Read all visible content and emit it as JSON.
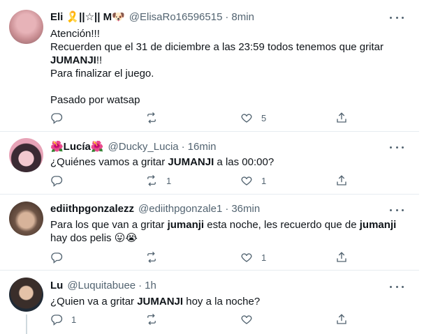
{
  "tweets": [
    {
      "name": "Eli 🎗️||☆|| M🐶",
      "handle": "@ElisaRo16596515",
      "sep": "·",
      "time": "8min",
      "lines": [
        "Atención!!!",
        "Recuerden que el 31 de diciembre a las 23:59 todos tenemos que gritar",
        "JUMANJI",
        "!!",
        "Para finalizar el juego.",
        "",
        "Pasado por watsap"
      ],
      "reply_count": "",
      "retweet_count": "",
      "like_count": "5"
    },
    {
      "name": "🌺Lucía🌺",
      "handle": "@Ducky_Lucia",
      "sep": "·",
      "time": "16min",
      "text_a": "¿Quiénes vamos a gritar ",
      "text_kw": "JUMANJI",
      "text_b": " a las 00:00?",
      "reply_count": "",
      "retweet_count": "1",
      "like_count": "1"
    },
    {
      "name": "ediithpgonzalezz",
      "handle": "@ediithpgonzale1",
      "sep": "·",
      "time": "36min",
      "text_a": "Para los que van a gritar ",
      "text_kw": "jumanji",
      "text_b": " esta noche, les recuerdo que de ",
      "text_kw2": "jumanji",
      "text_c": "hay dos pelis 😛😭",
      "reply_count": "",
      "retweet_count": "",
      "like_count": "1"
    },
    {
      "name": "Lu",
      "handle": "@Luquitabuee",
      "sep": "·",
      "time": "1h",
      "text_a": "¿Quien va a gritar ",
      "text_kw": "JUMANJI",
      "text_b": " hoy a la noche?",
      "reply_count": "1",
      "retweet_count": "",
      "like_count": ""
    }
  ],
  "icons": {
    "reply": "reply-icon",
    "retweet": "retweet-icon",
    "like": "heart-icon",
    "share": "share-icon",
    "more": "more-options-icon"
  },
  "colors": {
    "text": "#0f1419",
    "secondary": "#536471",
    "divider": "#e6ecf0"
  }
}
